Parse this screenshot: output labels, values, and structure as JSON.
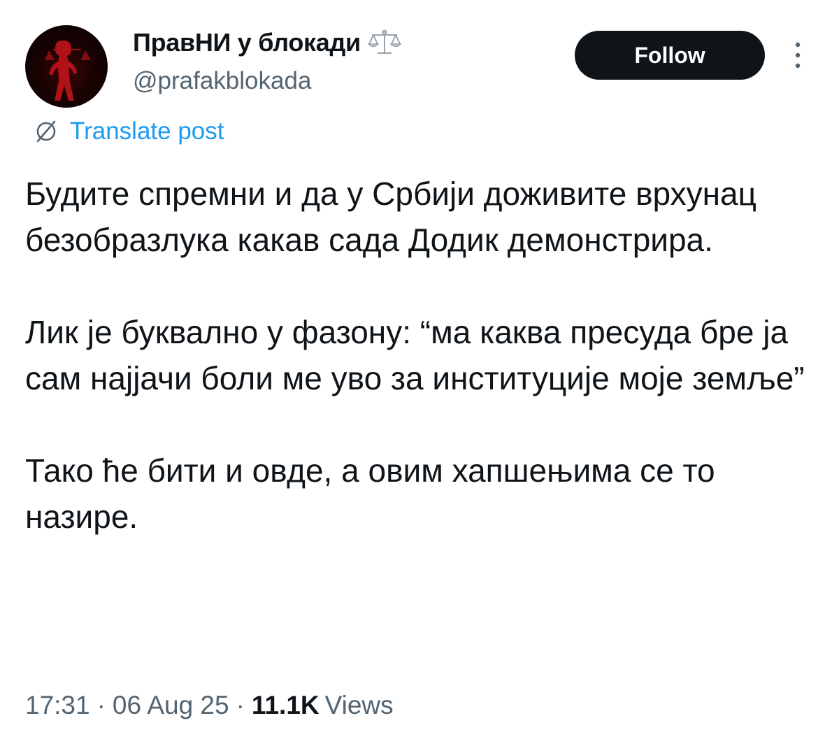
{
  "author": {
    "display_name": "ПравНИ у блокади",
    "name_emoji": "scales-icon",
    "handle": "@prafakblokada"
  },
  "actions": {
    "follow_label": "Follow",
    "more_icon": "more-vertical-icon"
  },
  "translate": {
    "label": "Translate post",
    "icon": "globe-icon"
  },
  "post": {
    "paragraphs": [
      "Будите спремни и да у Србији доживите врхунац безобразлука какав сада Додик демонстрира.",
      "Лик је буквално у фазону: “ма каква пресуда бре ја сам најјачи боли ме уво за институције моје земље”",
      "Тако ће бити и овде, а овим хапшењима се то назире."
    ]
  },
  "meta": {
    "time": "17:31",
    "date": "06 Aug 25",
    "views_count": "11.1K",
    "views_label": "Views"
  },
  "colors": {
    "text_primary": "#0f1419",
    "text_secondary": "#536471",
    "link": "#1d9bf0",
    "button_bg": "#0f1419"
  }
}
